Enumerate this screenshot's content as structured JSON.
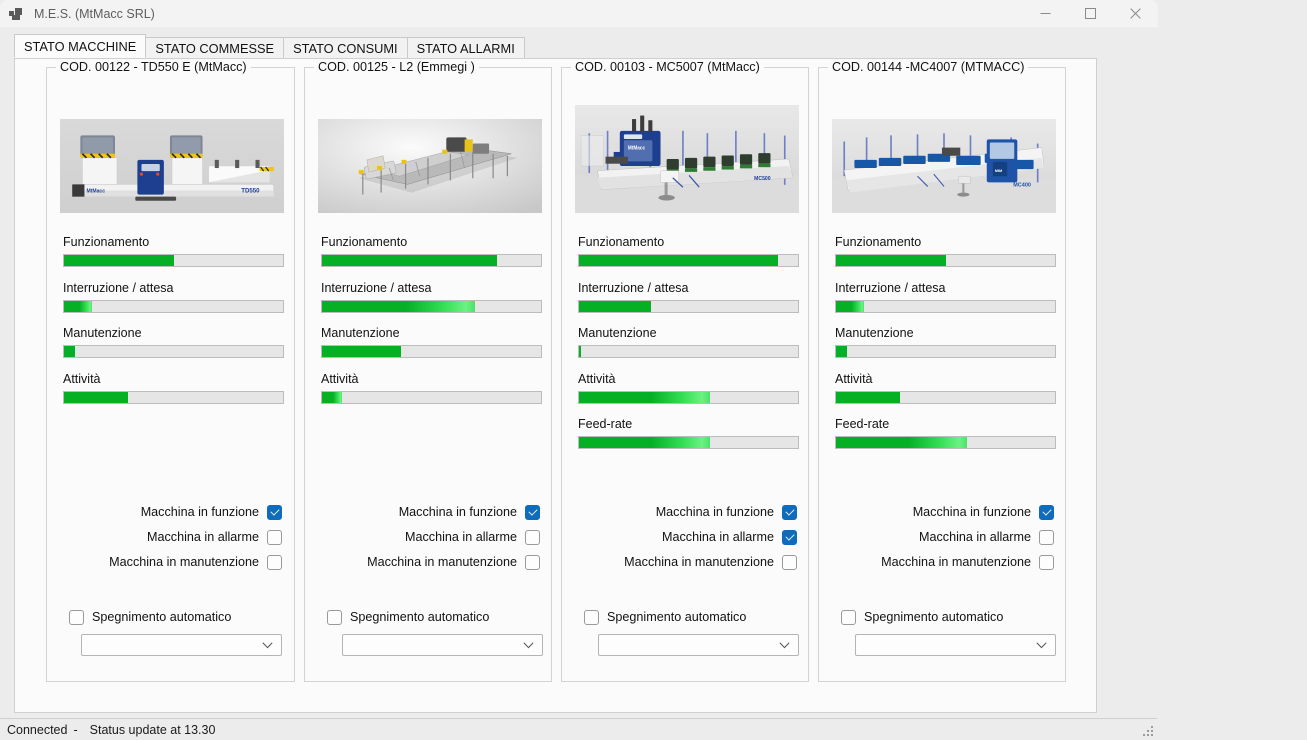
{
  "window": {
    "title": "M.E.S. (MtMacc SRL)",
    "icon": "app-tiles-icon",
    "controls": {
      "minimize": "minimize-icon",
      "maximize": "maximize-icon",
      "close": "close-icon"
    }
  },
  "tabs": [
    {
      "label": "STATO MACCHINE",
      "active": true
    },
    {
      "label": "STATO COMMESSE",
      "active": false
    },
    {
      "label": "STATO CONSUMI",
      "active": false
    },
    {
      "label": "STATO ALLARMI",
      "active": false
    }
  ],
  "labels": {
    "funzionamento": "Funzionamento",
    "interruzione": "Interruzione / attesa",
    "manutenzione": "Manutenzione",
    "attivita": "Attività",
    "feedrate": "Feed-rate",
    "macchina_in_funzione": "Macchina in funzione",
    "macchina_in_allarme": "Macchina in allarme",
    "macchina_in_manutenzione": "Macchina in manutenzione",
    "spegnimento_automatico": "Spegnimento automatico",
    "combo_value": "",
    "combo_placeholder": ""
  },
  "colors": {
    "bar_fill": "#06b025",
    "bar_track": "#e6e6e6",
    "checkbox_checked": "#0f6cbd",
    "tab_active_bg": "#fbfbfb",
    "window_bg": "#f3f3f3"
  },
  "machines": [
    {
      "title": "COD. 00122 - TD550 E (MtMacc)",
      "image": "machine-photo-td550e",
      "bars": [
        {
          "name": "funzionamento",
          "label": "Funzionamento",
          "percent": 50,
          "glow": false
        },
        {
          "name": "interruzione",
          "label": "Interruzione / attesa",
          "percent": 13,
          "glow": true
        },
        {
          "name": "manutenzione",
          "label": "Manutenzione",
          "percent": 5,
          "glow": false
        },
        {
          "name": "attivita",
          "label": "Attività",
          "percent": 29,
          "glow": false
        }
      ],
      "states": {
        "in_funzione": true,
        "in_allarme": false,
        "in_manutenzione": false,
        "spegnimento_automatico": false
      }
    },
    {
      "title": "COD. 00125 - L2 (Emmegi )",
      "image": "machine-photo-l2",
      "bars": [
        {
          "name": "funzionamento",
          "label": "Funzionamento",
          "percent": 80,
          "glow": false
        },
        {
          "name": "interruzione",
          "label": "Interruzione / attesa",
          "percent": 70,
          "glow": true
        },
        {
          "name": "manutenzione",
          "label": "Manutenzione",
          "percent": 36,
          "glow": false
        },
        {
          "name": "attivita",
          "label": "Attività",
          "percent": 9,
          "glow": true
        }
      ],
      "states": {
        "in_funzione": true,
        "in_allarme": false,
        "in_manutenzione": false,
        "spegnimento_automatico": false
      }
    },
    {
      "title": "COD. 00103 - MC5007 (MtMacc)",
      "image": "machine-photo-mc5007",
      "bars": [
        {
          "name": "funzionamento",
          "label": "Funzionamento",
          "percent": 91,
          "glow": false
        },
        {
          "name": "interruzione",
          "label": "Interruzione / attesa",
          "percent": 33,
          "glow": false
        },
        {
          "name": "manutenzione",
          "label": "Manutenzione",
          "percent": 1,
          "glow": false
        },
        {
          "name": "attivita",
          "label": "Attività",
          "percent": 60,
          "glow": true
        },
        {
          "name": "feedrate",
          "label": "Feed-rate",
          "percent": 60,
          "glow": true
        }
      ],
      "states": {
        "in_funzione": true,
        "in_allarme": true,
        "in_manutenzione": false,
        "spegnimento_automatico": false
      }
    },
    {
      "title": "COD. 00144 -MC4007 (MTMACC)",
      "image": "machine-photo-mc4007",
      "bars": [
        {
          "name": "funzionamento",
          "label": "Funzionamento",
          "percent": 50,
          "glow": false
        },
        {
          "name": "interruzione",
          "label": "Interruzione / attesa",
          "percent": 13,
          "glow": true
        },
        {
          "name": "manutenzione",
          "label": "Manutenzione",
          "percent": 5,
          "glow": false
        },
        {
          "name": "attivita",
          "label": "Attività",
          "percent": 29,
          "glow": false
        },
        {
          "name": "feedrate",
          "label": "Feed-rate",
          "percent": 60,
          "glow": true
        }
      ],
      "states": {
        "in_funzione": true,
        "in_allarme": false,
        "in_manutenzione": false,
        "spegnimento_automatico": false
      }
    }
  ],
  "statusbar": {
    "connection": "Connected",
    "separator": "-",
    "update": "Status update at 13.30"
  }
}
